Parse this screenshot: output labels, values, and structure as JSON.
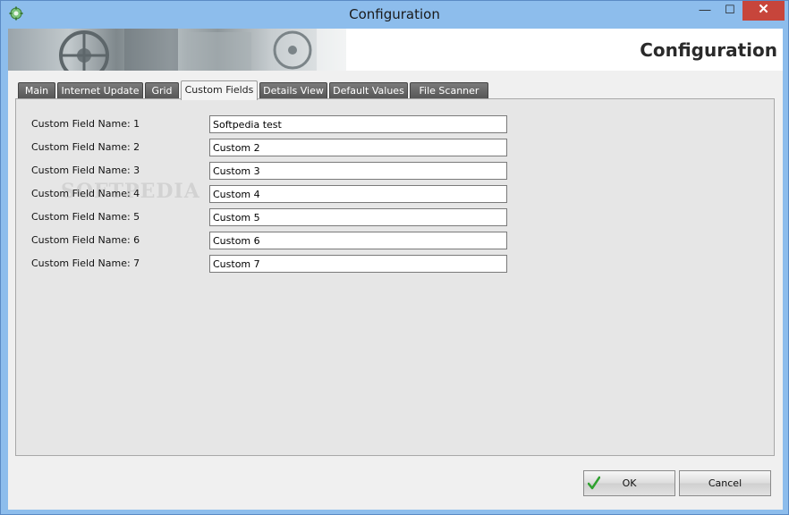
{
  "window": {
    "title": "Configuration",
    "minimize_glyph": "—",
    "maximize_glyph": "☐",
    "close_glyph": "✕"
  },
  "banner": {
    "title": "Configuration"
  },
  "tabs": [
    {
      "label": "Main",
      "active": false
    },
    {
      "label": "Internet Update",
      "active": false
    },
    {
      "label": "Grid",
      "active": false
    },
    {
      "label": "Custom Fields",
      "active": true
    },
    {
      "label": "Details View",
      "active": false
    },
    {
      "label": "Default Values",
      "active": false
    },
    {
      "label": "File Scanner",
      "active": false
    }
  ],
  "custom_fields": [
    {
      "label": "Custom Field Name: 1",
      "value": "Softpedia test"
    },
    {
      "label": "Custom Field Name: 2",
      "value": "Custom 2"
    },
    {
      "label": "Custom Field Name: 3",
      "value": "Custom 3"
    },
    {
      "label": "Custom Field Name: 4",
      "value": "Custom 4"
    },
    {
      "label": "Custom Field Name: 5",
      "value": "Custom 5"
    },
    {
      "label": "Custom Field Name: 6",
      "value": "Custom 6"
    },
    {
      "label": "Custom Field Name: 7",
      "value": "Custom 7"
    }
  ],
  "watermark": "SOFTPEDIA",
  "buttons": {
    "ok_label": "OK",
    "cancel_label": "Cancel"
  },
  "icons": {
    "app": "app-gear-icon",
    "ok": "checkmark-icon"
  },
  "colors": {
    "titlebar": "#8dbdec",
    "close_button": "#c7453b",
    "tab_inactive": "#666666",
    "ok_check": "#2fa12f"
  }
}
